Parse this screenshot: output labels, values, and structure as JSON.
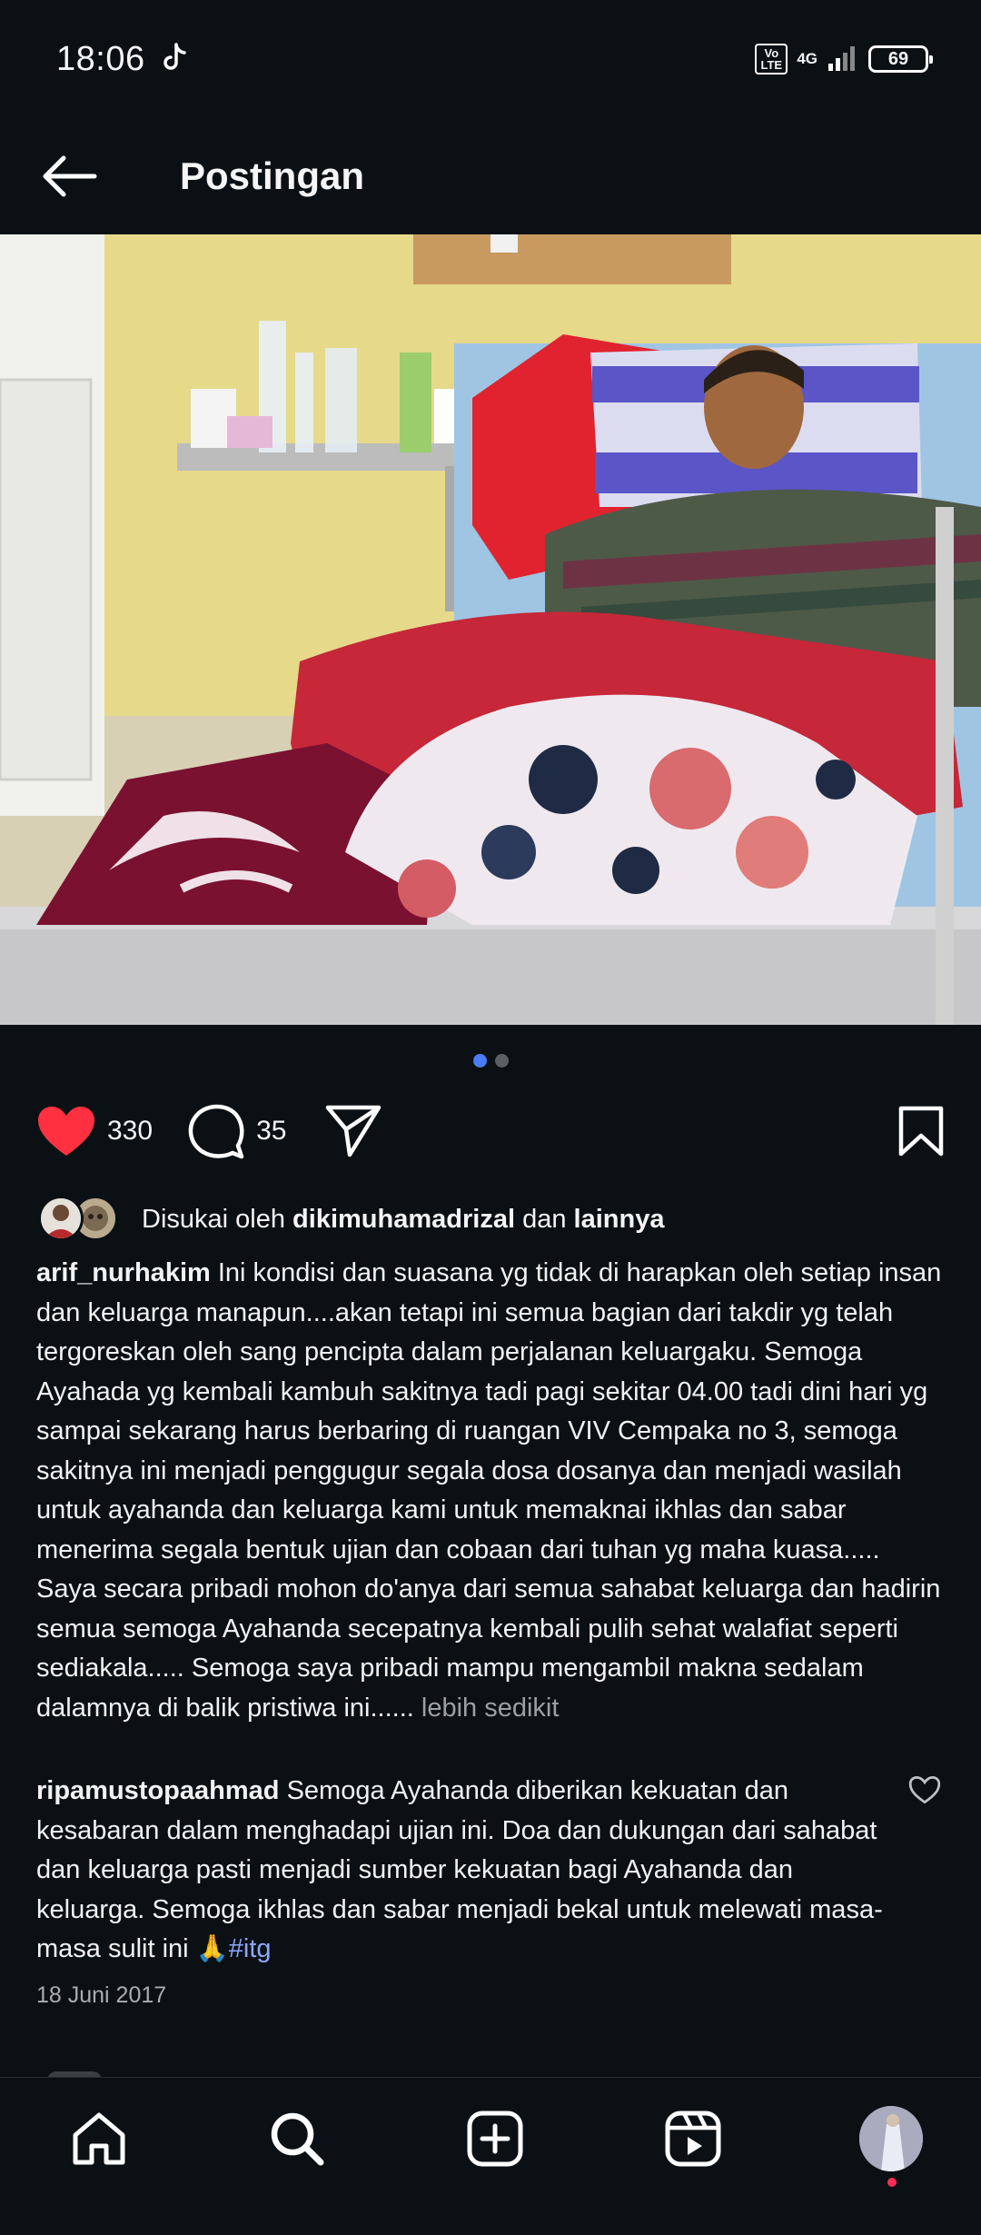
{
  "status": {
    "time": "18:06",
    "volte": "Vo LTE",
    "network": "4G",
    "battery": "69"
  },
  "header": {
    "title": "Postingan"
  },
  "post": {
    "likes_count": "330",
    "comments_count": "35",
    "liked_by_prefix": "Disukai oleh",
    "liked_by_user": "dikimuhamadrizal",
    "liked_by_join": "dan",
    "liked_by_others": "lainnya",
    "caption_user": "arif_nurhakim",
    "caption_p1": "Ini kondisi dan suasana yg tidak di harapkan oleh setiap insan dan keluarga manapun....akan tetapi ini semua bagian dari takdir yg telah tergoreskan oleh sang pencipta dalam perjalanan keluargaku. Semoga Ayahada yg kembali kambuh sakitnya tadi pagi sekitar 04.00 tadi dini hari yg sampai sekarang harus berbaring di ruangan VIV Cempaka no 3, semoga sakitnya ini menjadi penggugur segala dosa dosanya dan menjadi wasilah untuk ayahanda dan keluarga kami untuk memaknai ikhlas dan sabar menerima segala bentuk ujian dan cobaan dari tuhan yg maha kuasa.....",
    "caption_p2": "Saya secara pribadi mohon do'anya dari semua sahabat keluarga dan hadirin semua semoga Ayahanda secepatnya kembali pulih sehat walafiat seperti sediakala..... Semoga saya pribadi mampu mengambil makna sedalam dalamnya di balik pristiwa ini......",
    "less_label": "lebih sedikit",
    "comment_user": "ripamustopaahmad",
    "comment_text": "Semoga Ayahanda diberikan kekuatan dan kesabaran dalam menghadapi ujian ini. Doa dan dukungan dari sahabat dan keluarga pasti menjadi sumber kekuatan bagi Ayahanda dan keluarga. Semoga ikhlas dan sabar menjadi bekal untuk melewati masa-masa sulit ini 🙏",
    "comment_tag": "#itg",
    "date": "18 Juni 2017"
  },
  "colors": {
    "background": "#0b1014",
    "like_red": "#ff3040",
    "accent_blue": "#4a7cf5",
    "tag_blue": "#8ea7ff"
  },
  "icons": {
    "back": "arrow-left-icon",
    "like": "heart-filled-icon",
    "comment": "speech-bubble-icon",
    "share": "paper-plane-icon",
    "save": "bookmark-icon",
    "nav": [
      "home-icon",
      "search-icon",
      "create-icon",
      "reels-icon",
      "profile-avatar"
    ]
  }
}
